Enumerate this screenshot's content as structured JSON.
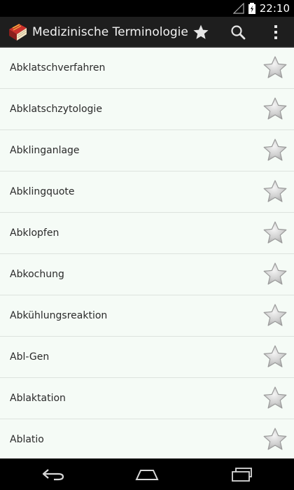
{
  "status_bar": {
    "time": "22:10"
  },
  "action_bar": {
    "title": "Medizinische Terminologie",
    "icons": [
      "book-icon",
      "star-icon",
      "search-icon",
      "overflow-menu-icon"
    ]
  },
  "list": {
    "items": [
      {
        "label": "Abklatschverfahren"
      },
      {
        "label": "Abklatschzytologie"
      },
      {
        "label": "Abklinganlage"
      },
      {
        "label": "Abklingquote"
      },
      {
        "label": "Abklopfen"
      },
      {
        "label": "Abkochung"
      },
      {
        "label": "Abkühlungsreaktion"
      },
      {
        "label": "Abl-Gen"
      },
      {
        "label": "Ablaktation"
      },
      {
        "label": "Ablatio"
      }
    ]
  },
  "colors": {
    "action_bar_bg": "#1e1e1e",
    "list_bg": "#f5fbf6",
    "star_fill": "#c8c8c8"
  }
}
